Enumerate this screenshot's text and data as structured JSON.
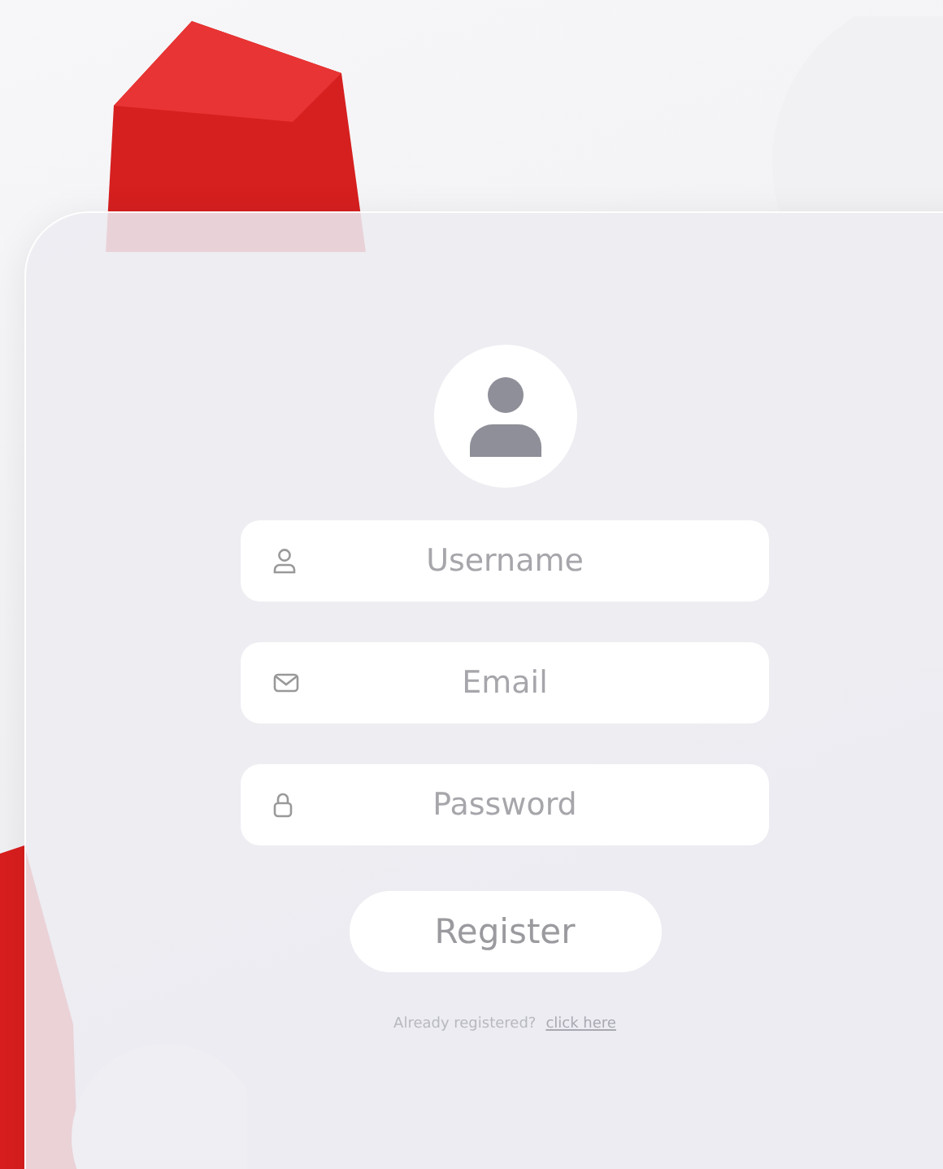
{
  "form": {
    "fields": [
      {
        "kind": "user",
        "placeholder": "Username"
      },
      {
        "kind": "email",
        "placeholder": "Email"
      },
      {
        "kind": "password",
        "placeholder": "Password"
      }
    ],
    "submit": {
      "label": "Register"
    },
    "footer": {
      "text": "Already registered?",
      "link": "click here"
    }
  }
}
